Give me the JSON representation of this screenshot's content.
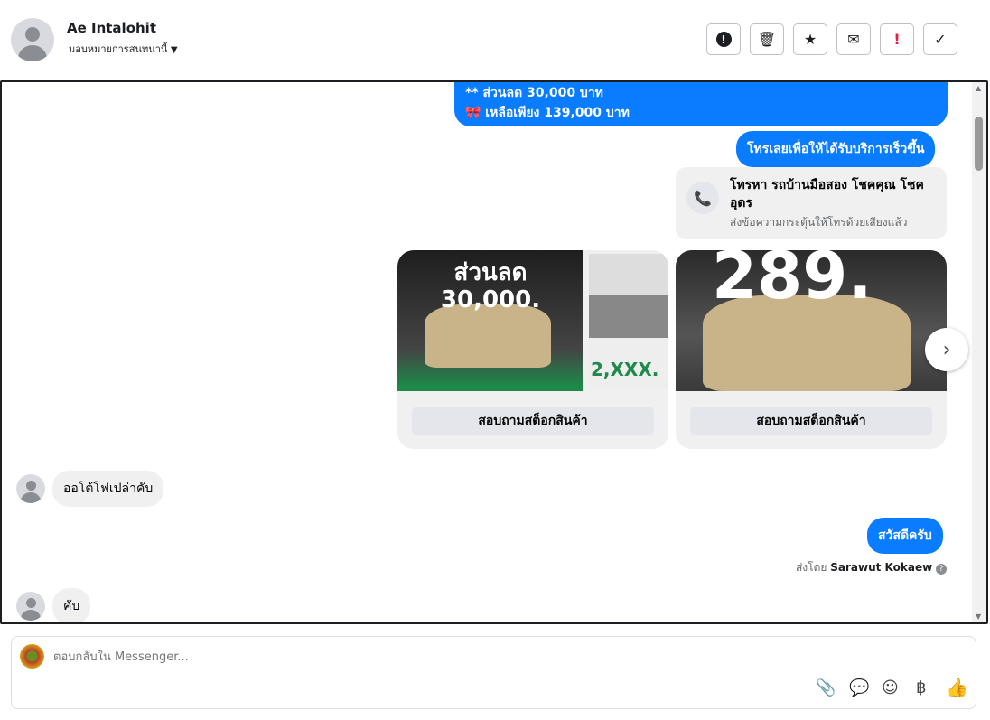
{
  "header": {
    "name": "Ae Intalohit",
    "assign_label": "มอบหมายการสนทนานี้",
    "actions": [
      {
        "icon": "alert-circle-icon",
        "glyph": "❗"
      },
      {
        "icon": "trash-icon",
        "glyph": "🗑"
      },
      {
        "icon": "star-icon",
        "glyph": "★"
      },
      {
        "icon": "mail-icon",
        "glyph": "✉"
      },
      {
        "icon": "exclamation-icon",
        "glyph": "!"
      },
      {
        "icon": "check-icon",
        "glyph": "✓"
      }
    ]
  },
  "messages": {
    "promo_line1": "** ส่วนลด 30,000 บาท",
    "promo_line2": "🎀 เหลือเพียง 139,000 บาท",
    "call_prompt": "โทรเลยเพื่อให้ได้รับบริการเร็วขึ้น",
    "call_card": {
      "title": "โทรหา รถบ้านมือสอง โชคคุณ โชคอุดร",
      "subtitle": "ส่งข้อความกระตุ้นให้โทรด้วยเสียงแล้ว"
    },
    "carousel": [
      {
        "image_text": "ส่วนลด 30,000.",
        "side_text": "2,XXX.",
        "button": "สอบถามสต็อกสินค้า"
      },
      {
        "image_text": "289.",
        "button": "สอบถามสต็อกสินค้า"
      }
    ],
    "received1": "ออโต้โฟเปล่าคับ",
    "sent_hello": "สวัสดีครับ",
    "sent_by_label": "ส่งโดย",
    "sent_by_name": "Sarawut Kokaew",
    "received2": "คับ"
  },
  "composer": {
    "placeholder": "ตอบกลับใน Messenger...",
    "currency": "฿"
  },
  "colors": {
    "accent": "#0a7cff",
    "bubble_grey": "#f0f0f0"
  }
}
